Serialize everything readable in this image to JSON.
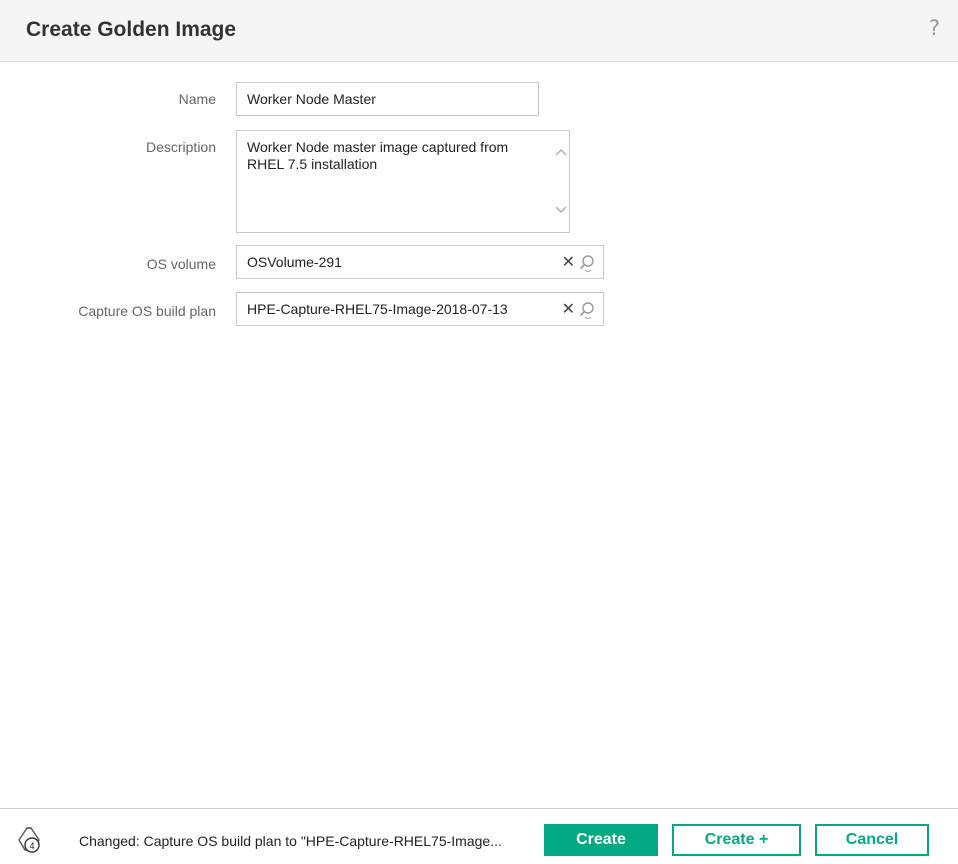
{
  "dialog": {
    "title": "Create Golden Image",
    "help_label": "?"
  },
  "form": {
    "name": {
      "label": "Name",
      "value": "Worker Node Master"
    },
    "description": {
      "label": "Description",
      "value": "Worker Node master image captured from RHEL 7.5 installation"
    },
    "os_volume": {
      "label": "OS volume",
      "value": "OSVolume-291",
      "clear_label": "✕"
    },
    "build_plan": {
      "label": "Capture OS build plan",
      "value": "HPE-Capture-RHEL75-Image-2018-07-13",
      "clear_label": "✕"
    }
  },
  "footer": {
    "change_count": "4",
    "status_text": "Changed: Capture OS build plan to \"HPE-Capture-RHEL75-Image...",
    "create_label": "Create",
    "create_plus_label": "Create +",
    "cancel_label": "Cancel"
  },
  "colors": {
    "accent": "#01a982",
    "header_bg": "#f5f5f5",
    "label_text": "#666666"
  },
  "icons": {
    "help": "help-icon",
    "clear": "clear-icon",
    "search": "search-icon",
    "changes": "changes-notification-icon"
  }
}
